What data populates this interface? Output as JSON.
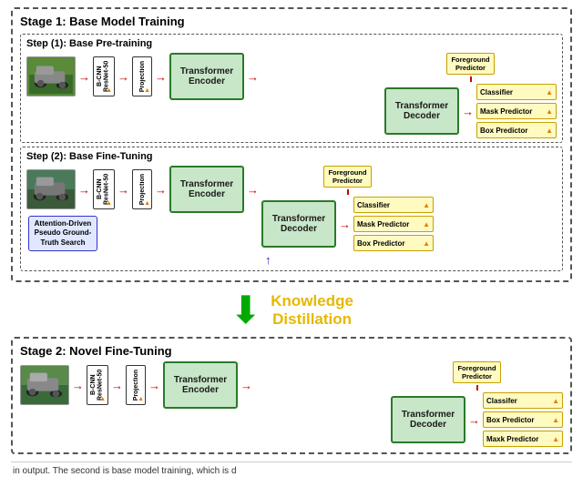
{
  "stage1": {
    "title": "Stage 1: Base Model Training",
    "step1": {
      "label": "Step (1): Base Pre-training",
      "fg_predictor": "Foreground\nPredictor",
      "transformer_encoder": "Transformer\nEncoder",
      "transformer_decoder": "Transformer\nDecoder",
      "backbone": "B-CNN\nResNet-50",
      "projection": "Projection",
      "outputs": [
        "Classifier",
        "Mask Predictor",
        "Box Predictor"
      ]
    },
    "step2": {
      "label": "Step (2): Base Fine-Tuning",
      "fg_predictor": "Foreground\nPredictor",
      "transformer_encoder": "Transformer\nEncoder",
      "transformer_decoder": "Transformer\nDecoder",
      "backbone": "B-CNN\nResNet-50",
      "projection": "Projection",
      "outputs": [
        "Classifier",
        "Mask Predictor",
        "Box Predictor"
      ],
      "attention_box": "Attention-Driven\nPseudo Ground-\nTruth Search"
    }
  },
  "kd": {
    "arrow": "⬇",
    "line1": "Knowledge",
    "line2": "Distillation"
  },
  "stage2": {
    "title": "Stage 2: Novel Fine-Tuning",
    "fg_predictor": "Foreground\nPredictor",
    "transformer_encoder": "Transformer\nEncoder",
    "transformer_decoder": "Transformer\nDecoder",
    "backbone": "B-CNN\nResNet-50",
    "projection": "Projection",
    "outputs": [
      "Classifer",
      "Box Predictor",
      "Maxk Predictor"
    ]
  },
  "bottom_text": "in output. The second is base model training, which is d"
}
